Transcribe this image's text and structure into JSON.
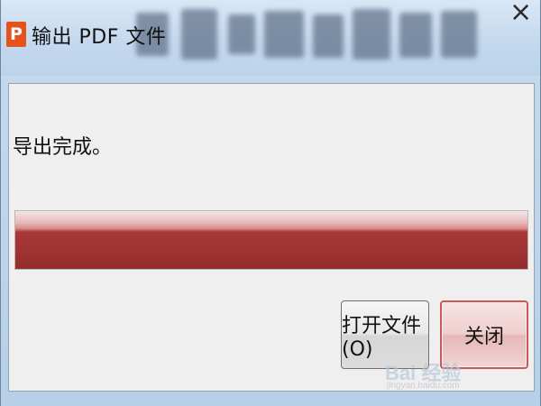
{
  "window": {
    "title": "输出 PDF 文件",
    "app_icon_letter": "P",
    "close_glyph": "×"
  },
  "dialog": {
    "message": "导出完成。",
    "progress_fraction": 1.0,
    "buttons": {
      "open_file_label": "打开文件(O)",
      "close_label": "关闭"
    }
  },
  "watermark": {
    "logo": "Bai 经验",
    "sub": "jingyan.baidu.com"
  },
  "colors": {
    "progress_fill": "#a03333",
    "app_icon_bg": "#e4531c",
    "close_button_border": "#c85a5a",
    "title_bar_bg": "#c8dbee",
    "client_bg": "#efefef"
  },
  "icons": {
    "app_icon": "pdf-export-app-icon",
    "close_icon": "close-icon"
  }
}
